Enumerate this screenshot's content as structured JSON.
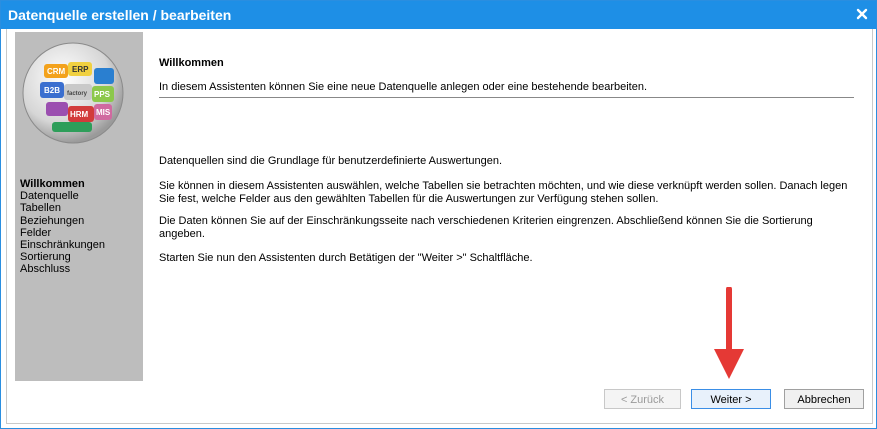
{
  "window": {
    "title": "Datenquelle erstellen / bearbeiten"
  },
  "logo": {
    "words": [
      "CRM",
      "ERP",
      "B2B",
      "PPS",
      "HRM",
      "MIS",
      "factory"
    ]
  },
  "sidebar": {
    "steps": [
      {
        "label": "Willkommen",
        "active": true
      },
      {
        "label": "Datenquelle",
        "active": false
      },
      {
        "label": "Tabellen",
        "active": false
      },
      {
        "label": "Beziehungen",
        "active": false
      },
      {
        "label": "Felder",
        "active": false
      },
      {
        "label": "Einschränkungen",
        "active": false
      },
      {
        "label": "Sortierung",
        "active": false
      },
      {
        "label": "Abschluss",
        "active": false
      }
    ]
  },
  "main": {
    "heading": "Willkommen",
    "intro": "In diesem Assistenten können Sie eine neue Datenquelle anlegen oder eine bestehende bearbeiten.",
    "paragraphs": [
      "Datenquellen sind die Grundlage für benutzerdefinierte Auswertungen.",
      "Sie können in diesem Assistenten auswählen, welche Tabellen sie betrachten möchten, und wie diese verknüpft werden sollen. Danach legen Sie fest, welche Felder aus den gewählten Tabellen für die Auswertungen zur Verfügung stehen sollen.",
      "Die Daten können Sie auf der Einschränkungsseite nach verschiedenen Kriterien eingrenzen. Abschließend können Sie die Sortierung angeben.",
      "Starten Sie nun den Assistenten durch Betätigen der \"Weiter >\" Schaltfläche."
    ]
  },
  "buttons": {
    "back": "< Zurück",
    "next": "Weiter >",
    "cancel": "Abbrechen"
  },
  "colors": {
    "titlebar": "#1e8fe6",
    "sidebar": "#bdbdbd",
    "arrow": "#e53935"
  }
}
